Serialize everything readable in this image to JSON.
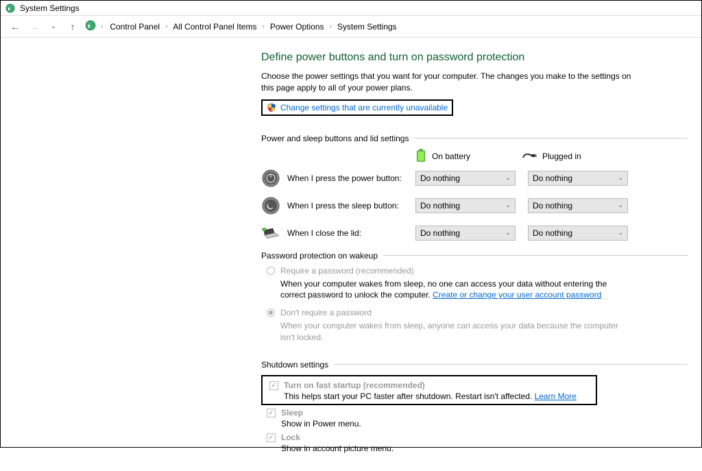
{
  "title": "System Settings",
  "breadcrumb": [
    "Control Panel",
    "All Control Panel Items",
    "Power Options",
    "System Settings"
  ],
  "heading": "Define power buttons and turn on password protection",
  "desc": "Choose the power settings that you want for your computer. The changes you make to the settings on this page apply to all of your power plans.",
  "change_link": "Change settings that are currently unavailable",
  "sec_buttons": "Power and sleep buttons and lid settings",
  "col_battery": "On battery",
  "col_plugged": "Plugged in",
  "rows": {
    "power": {
      "label": "When I press the power button:",
      "bat": "Do nothing",
      "plug": "Do nothing"
    },
    "sleep": {
      "label": "When I press the sleep button:",
      "bat": "Do nothing",
      "plug": "Do nothing"
    },
    "lid": {
      "label": "When I close the lid:",
      "bat": "Do nothing",
      "plug": "Do nothing"
    }
  },
  "sec_pass": "Password protection on wakeup",
  "opt_require": "Require a password (recommended)",
  "opt_require_desc": "When your computer wakes from sleep, no one can access your data without entering the correct password to unlock the computer. ",
  "opt_require_link": "Create or change your user account password",
  "opt_dont": "Don't require a password",
  "opt_dont_desc": "When your computer wakes from sleep, anyone can access your data because the computer isn't locked.",
  "sec_shutdown": "Shutdown settings",
  "shutdown": {
    "fast_label": "Turn on fast startup (recommended)",
    "fast_desc": "This helps start your PC faster after shutdown. Restart isn't affected. ",
    "learn_more": "Learn More",
    "sleep_label": "Sleep",
    "sleep_desc": "Show in Power menu.",
    "lock_label": "Lock",
    "lock_desc": "Show in account picture menu."
  }
}
